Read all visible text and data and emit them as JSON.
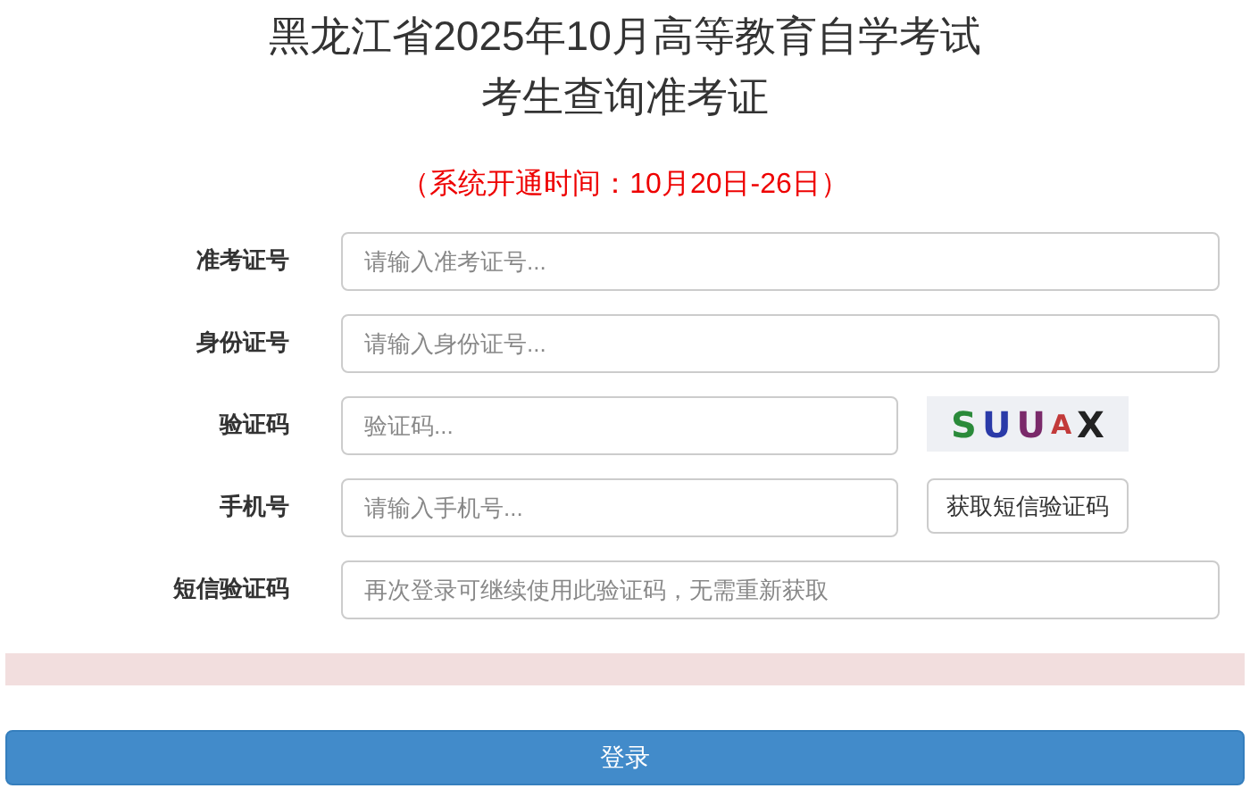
{
  "title_lines": [
    "黑龙江省2025年10月高等教育自学考试",
    "考生查询准考证"
  ],
  "notice": "（系统开通时间：10月20日-26日）",
  "fields": [
    {
      "kind": "text",
      "label": "准考证号",
      "placeholder": "请输入准考证号..."
    },
    {
      "kind": "text",
      "label": "身份证号",
      "placeholder": "请输入身份证号..."
    },
    {
      "kind": "captcha",
      "label": "验证码",
      "placeholder": "验证码...",
      "captcha": "SUUAX"
    },
    {
      "kind": "sms",
      "label": "手机号",
      "placeholder": "请输入手机号...",
      "button": "获取短信验证码"
    },
    {
      "kind": "text",
      "label": "短信验证码",
      "placeholder": "再次登录可继续使用此验证码，无需重新获取"
    }
  ],
  "submit": "登录"
}
